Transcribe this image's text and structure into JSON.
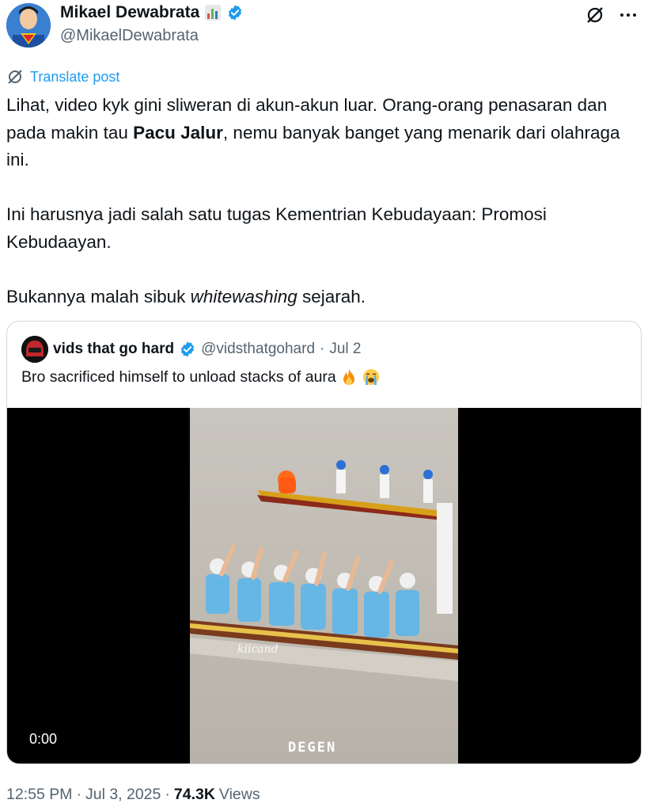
{
  "author": {
    "display_name": "Mikael Dewabrata",
    "handle": "@MikaelDewabrata"
  },
  "translate_label": "Translate post",
  "body": {
    "p1_a": "Lihat, video kyk gini sliweran di akun-akun luar. Orang-orang penasaran dan pada makin tau ",
    "p1_bold": "Pacu Jalur",
    "p1_b": ", nemu banyak banget yang menarik dari olahraga ini.",
    "p2": "Ini harusnya jadi salah satu tugas Kementrian Kebudayaan: Promosi Kebudaayan.",
    "p3_a": "Bukannya malah sibuk ",
    "p3_italic": "whitewashing",
    "p3_b": " sejarah."
  },
  "quote": {
    "display_name": "vids that go hard",
    "handle": "@vidsthatgohard",
    "separator": "·",
    "date": "Jul 2",
    "text": "Bro sacrificed himself to unload stacks of aura",
    "emojis": [
      "fire",
      "loudly-crying-face"
    ],
    "video": {
      "time": "0:00",
      "watermark": "kiicand",
      "brand": "DEGEN"
    }
  },
  "footer": {
    "time": "12:55 PM",
    "sep1": "·",
    "date": "Jul 3, 2025",
    "sep2": "·",
    "views_count": "74.3K",
    "views_label": "Views"
  },
  "colors": {
    "accent": "#1d9bf0",
    "text": "#0f1419",
    "secondary": "#536471",
    "border": "#cfd9de"
  }
}
